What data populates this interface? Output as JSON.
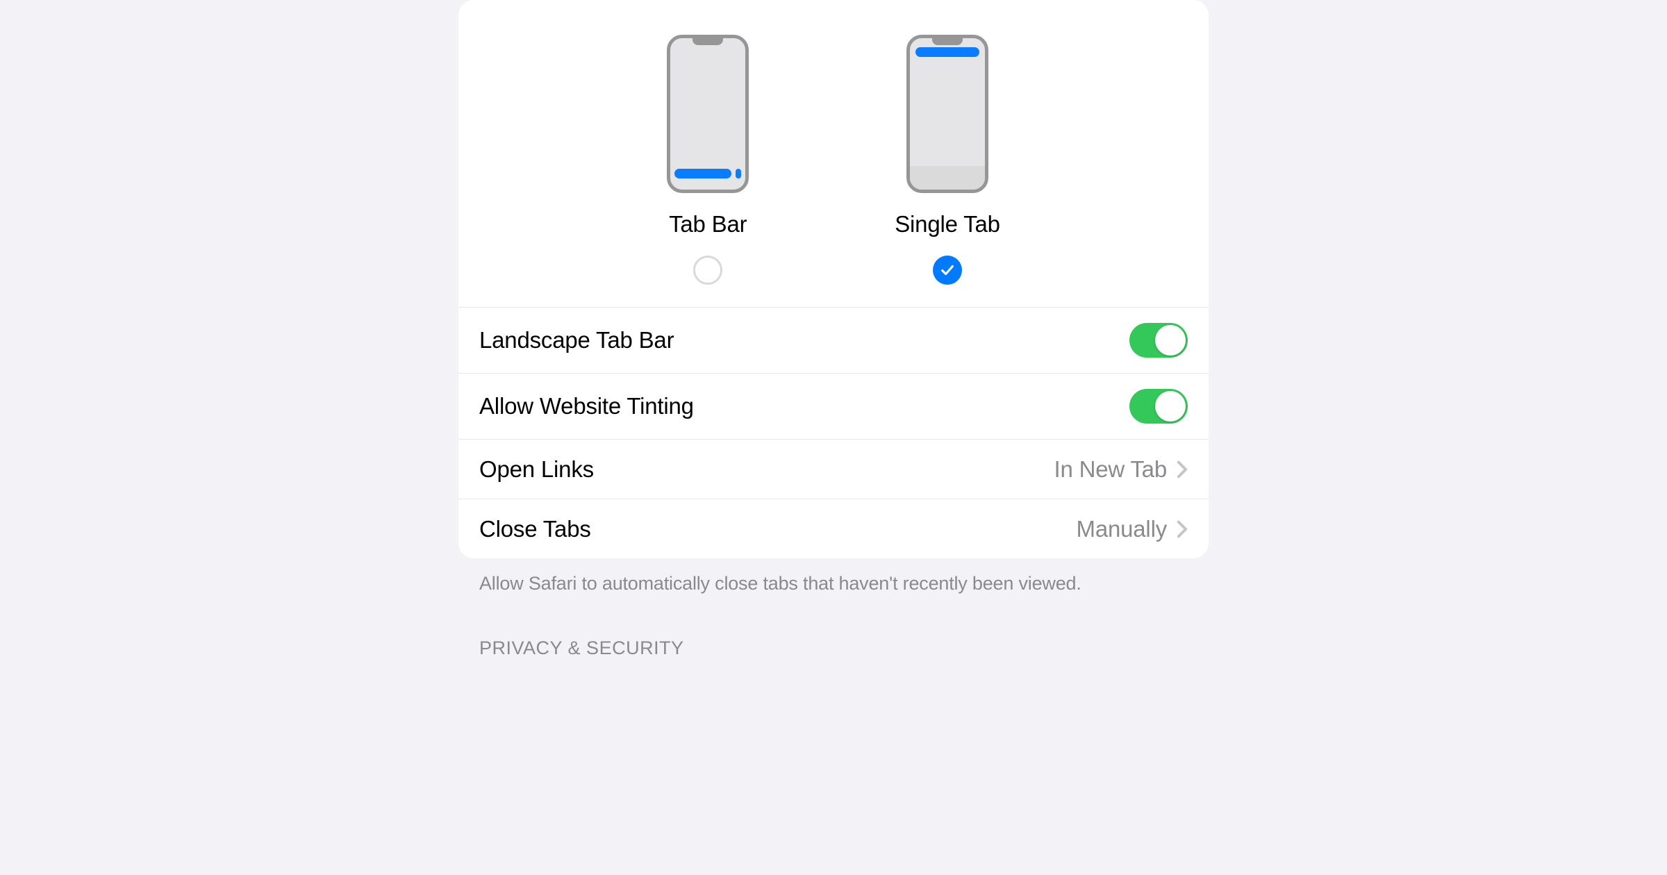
{
  "layout_picker": {
    "options": [
      {
        "label": "Tab Bar",
        "selected": false
      },
      {
        "label": "Single Tab",
        "selected": true
      }
    ]
  },
  "rows": {
    "landscape_tab_bar": {
      "label": "Landscape Tab Bar",
      "on": true
    },
    "allow_website_tinting": {
      "label": "Allow Website Tinting",
      "on": true
    },
    "open_links": {
      "label": "Open Links",
      "value": "In New Tab"
    },
    "close_tabs": {
      "label": "Close Tabs",
      "value": "Manually"
    }
  },
  "footer": "Allow Safari to automatically close tabs that haven't recently been viewed.",
  "next_section_header": "PRIVACY & SECURITY"
}
